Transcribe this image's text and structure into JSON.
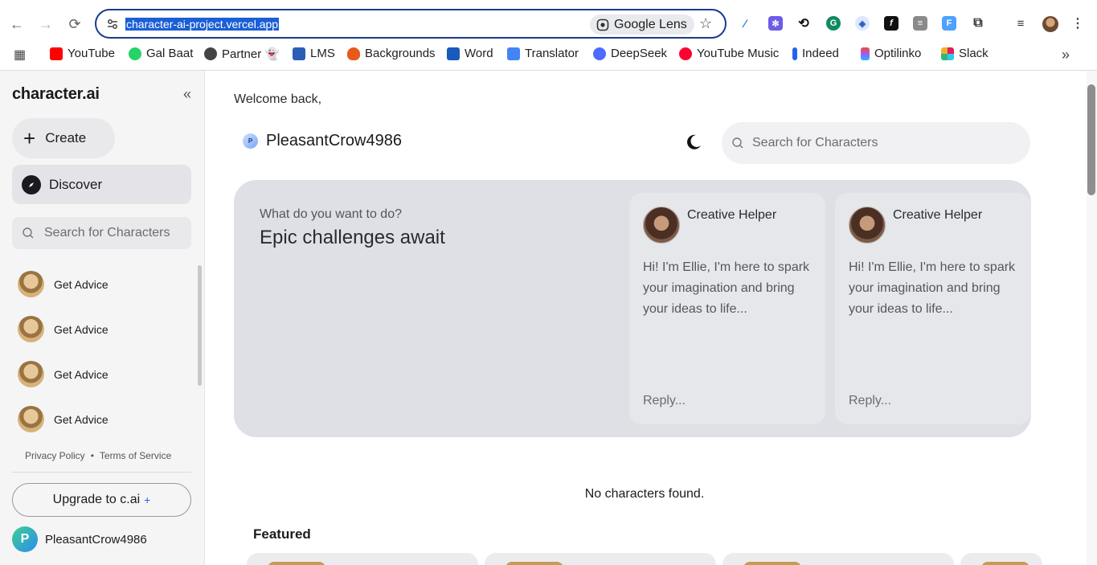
{
  "browser": {
    "url": "character-ai-project.vercel.app",
    "lens_label": "Google Lens",
    "bookmarks": [
      {
        "label": "YouTube",
        "color": "#ff0000"
      },
      {
        "label": "Gal Baat",
        "color": "#25d366"
      },
      {
        "label": "Partner 👻",
        "color": "#444444"
      },
      {
        "label": "LMS",
        "color": "#2b5db7"
      },
      {
        "label": "Backgrounds",
        "color": "#e8591a"
      },
      {
        "label": "Word",
        "color": "#185abd"
      },
      {
        "label": "Translator",
        "color": "#4285f4"
      },
      {
        "label": "DeepSeek",
        "color": "#4d6bfe"
      },
      {
        "label": "YouTube Music",
        "color": "#ff0033"
      },
      {
        "label": "Indeed",
        "color": "#2164f3"
      },
      {
        "label": "Optilinko",
        "color": "#a259ff"
      },
      {
        "label": "Slack",
        "color": "#e01e5a"
      }
    ]
  },
  "sidebar": {
    "logo": "character.ai",
    "create_label": "Create",
    "discover_label": "Discover",
    "search_placeholder": "Search for Characters",
    "chats": [
      {
        "name": "Get Advice"
      },
      {
        "name": "Get Advice"
      },
      {
        "name": "Get Advice"
      },
      {
        "name": "Get Advice"
      }
    ],
    "privacy_label": "Privacy Policy",
    "separator": "•",
    "terms_label": "Terms of Service",
    "upgrade_label": "Upgrade to c.ai",
    "upgrade_plus": "+",
    "user_initial": "P",
    "username": "PleasantCrow4986"
  },
  "main": {
    "welcome": "Welcome back,",
    "user_initial": "P",
    "username": "PleasantCrow4986",
    "search_placeholder": "Search for Characters",
    "hero": {
      "question": "What do you want to do?",
      "title": "Epic challenges await",
      "cards": [
        {
          "name": "Creative Helper",
          "message": "Hi! I'm Ellie, I'm here to spark your imagination and bring your ideas to life...",
          "reply": "Reply..."
        },
        {
          "name": "Creative Helper",
          "message": "Hi! I'm Ellie, I'm here to spark your imagination and bring your ideas to life...",
          "reply": "Reply..."
        }
      ]
    },
    "empty_message": "No characters found.",
    "featured_label": "Featured"
  },
  "colors": {
    "accent": "#1a3c8e",
    "hero_bg": "#dfe0e6",
    "sidebar_bg": "#f5f5f6"
  }
}
